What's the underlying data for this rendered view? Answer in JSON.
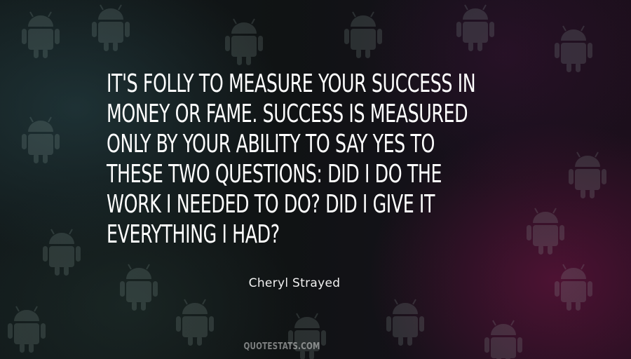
{
  "quote": {
    "lines": [
      "It's folly to measure your success in",
      "money or fame. Success is measured",
      "only by your ability to say yes to",
      "these two questions: Did I do the",
      "work I needed to do? Did I give it",
      "everything I had?"
    ]
  },
  "author": "Cheryl Strayed",
  "watermark": "QUOTESTATS.COM",
  "background": {
    "pattern_icon": "android-robot-icon",
    "colors": {
      "left_tint": "#2a4a4e",
      "right_tint": "#7a1446",
      "base": "#101314"
    }
  }
}
